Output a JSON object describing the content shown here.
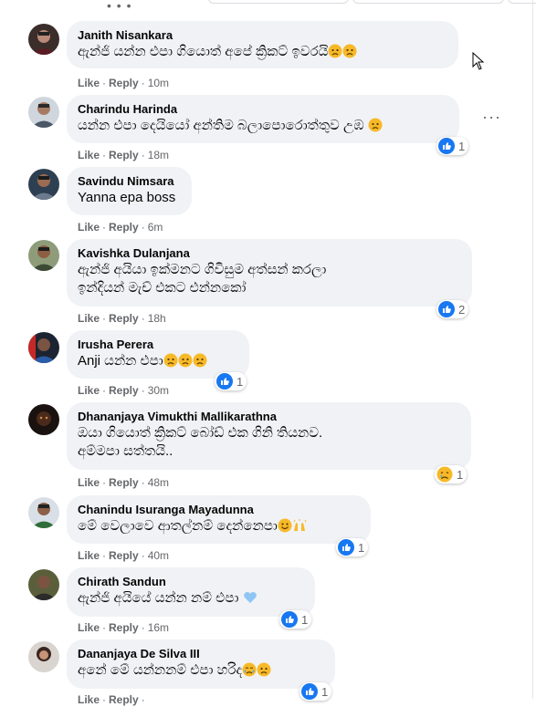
{
  "actions": {
    "like": "Like",
    "reply": "Reply",
    "separator": "·"
  },
  "top": {
    "dots": "• • •"
  },
  "comments": [
    {
      "name": "Janith Nisankara",
      "text": "ඇන්ජි යන්න එපා ගියොත් අපේ ක්‍රිකට් ඉවරයි",
      "emojis": [
        "sad",
        "sad"
      ],
      "time": "10m",
      "reaction_count": ""
    },
    {
      "name": "Charindu Harinda",
      "text": "යන්න එපා දෙයියෝ අන්තිම බලාපොරොත්තුව උඹ",
      "emojis": [
        "sad"
      ],
      "time": "18m",
      "reaction_count": "1"
    },
    {
      "name": "Savindu Nimsara",
      "text": "Yanna epa boss",
      "emojis": [],
      "time": "6m",
      "reaction_count": ""
    },
    {
      "name": "Kavishka Dulanjana",
      "text": "ඇන්ජි අයියා ඉක්මනට ගිවිසුම අත්සන් කරලා",
      "text2": "ඉන්දියන් මැච් එකට එන්නකෝ",
      "emojis": [],
      "time": "18h",
      "reaction_count": "2"
    },
    {
      "name": "Irusha Perera",
      "text": "Anji යන්න එපා",
      "emojis": [
        "sad",
        "sad",
        "sad"
      ],
      "time": "30m",
      "reaction_count": "1"
    },
    {
      "name": "Dhananjaya Vimukthi Mallikarathna",
      "text": "ඔයා ගියොත් ක්‍රිකට් බෝඩ් එක ගිනි තියනව.",
      "text2": "අම්මපා සත්තයි..",
      "emojis": [],
      "time": "48m",
      "reaction_count": "1"
    },
    {
      "name": "Chanindu Isuranga Mayadunna",
      "text": "මේ වෙලාවෙ ආතල්නම් දෙන්නෙපා",
      "emojis": [
        "smile",
        "hands"
      ],
      "time": "40m",
      "reaction_count": "1"
    },
    {
      "name": "Chirath Sandun",
      "text": "ඇන්ජි අයියේ යන්න නම් එපා",
      "emojis": [
        "heart"
      ],
      "time": "16m",
      "reaction_count": "1"
    },
    {
      "name": "Dananjaya De Silva III",
      "text": "අනේ මේ යන්නනම් එපා හරිද",
      "emojis": [
        "cry",
        "sad"
      ],
      "time": "",
      "reaction_count": "1"
    }
  ],
  "colors": {
    "bubble": "#f0f2f5",
    "like_blue": "#1877f2",
    "meta_gray": "#65676b"
  }
}
